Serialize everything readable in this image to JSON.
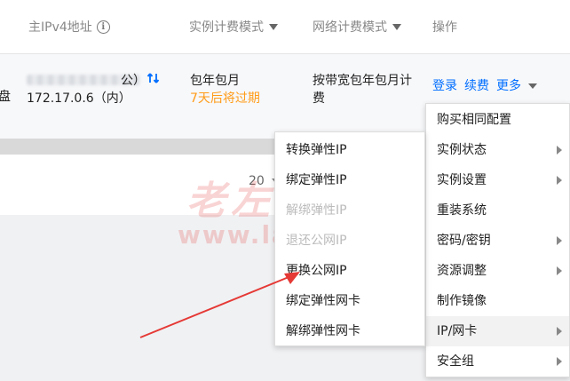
{
  "header": {
    "col_ipv4": "主IPv4地址",
    "col_instance_billing": "实例计费模式",
    "col_network_billing": "网络计费模式",
    "col_ops": "操作"
  },
  "row": {
    "left_cut": "盘",
    "ip_public_suffix": "公）",
    "ip_private": "172.17.0.6（内）",
    "instance_billing": "包年包月",
    "expire_note": "7天后将过期",
    "network_billing_line1": "按带宽包年包月计",
    "network_billing_line2": "费",
    "op_login": "登录",
    "op_renew": "续费",
    "op_more": "更多"
  },
  "pager": {
    "page_size": "20"
  },
  "more_menu": [
    {
      "label": "购买相同配置",
      "has_sub": false,
      "active": false
    },
    {
      "label": "实例状态",
      "has_sub": true,
      "active": false
    },
    {
      "label": "实例设置",
      "has_sub": true,
      "active": false
    },
    {
      "label": "重装系统",
      "has_sub": false,
      "active": false
    },
    {
      "label": "密码/密钥",
      "has_sub": true,
      "active": false
    },
    {
      "label": "资源调整",
      "has_sub": true,
      "active": false
    },
    {
      "label": "制作镜像",
      "has_sub": false,
      "active": false
    },
    {
      "label": "IP/网卡",
      "has_sub": true,
      "active": true
    },
    {
      "label": "安全组",
      "has_sub": true,
      "active": false
    }
  ],
  "ip_submenu": [
    {
      "label": "转换弹性IP",
      "disabled": false
    },
    {
      "label": "绑定弹性IP",
      "disabled": false
    },
    {
      "label": "解绑弹性IP",
      "disabled": true
    },
    {
      "label": "退还公网IP",
      "disabled": true
    },
    {
      "label": "更换公网IP",
      "disabled": false
    },
    {
      "label": "绑定弹性网卡",
      "disabled": false
    },
    {
      "label": "解绑弹性网卡",
      "disabled": false
    }
  ],
  "watermark": {
    "line1": "老左笔记",
    "line2": "www.laozuo.org"
  },
  "colors": {
    "link": "#006eff",
    "warning": "#ff9c19",
    "annotation_arrow": "#e53935"
  }
}
